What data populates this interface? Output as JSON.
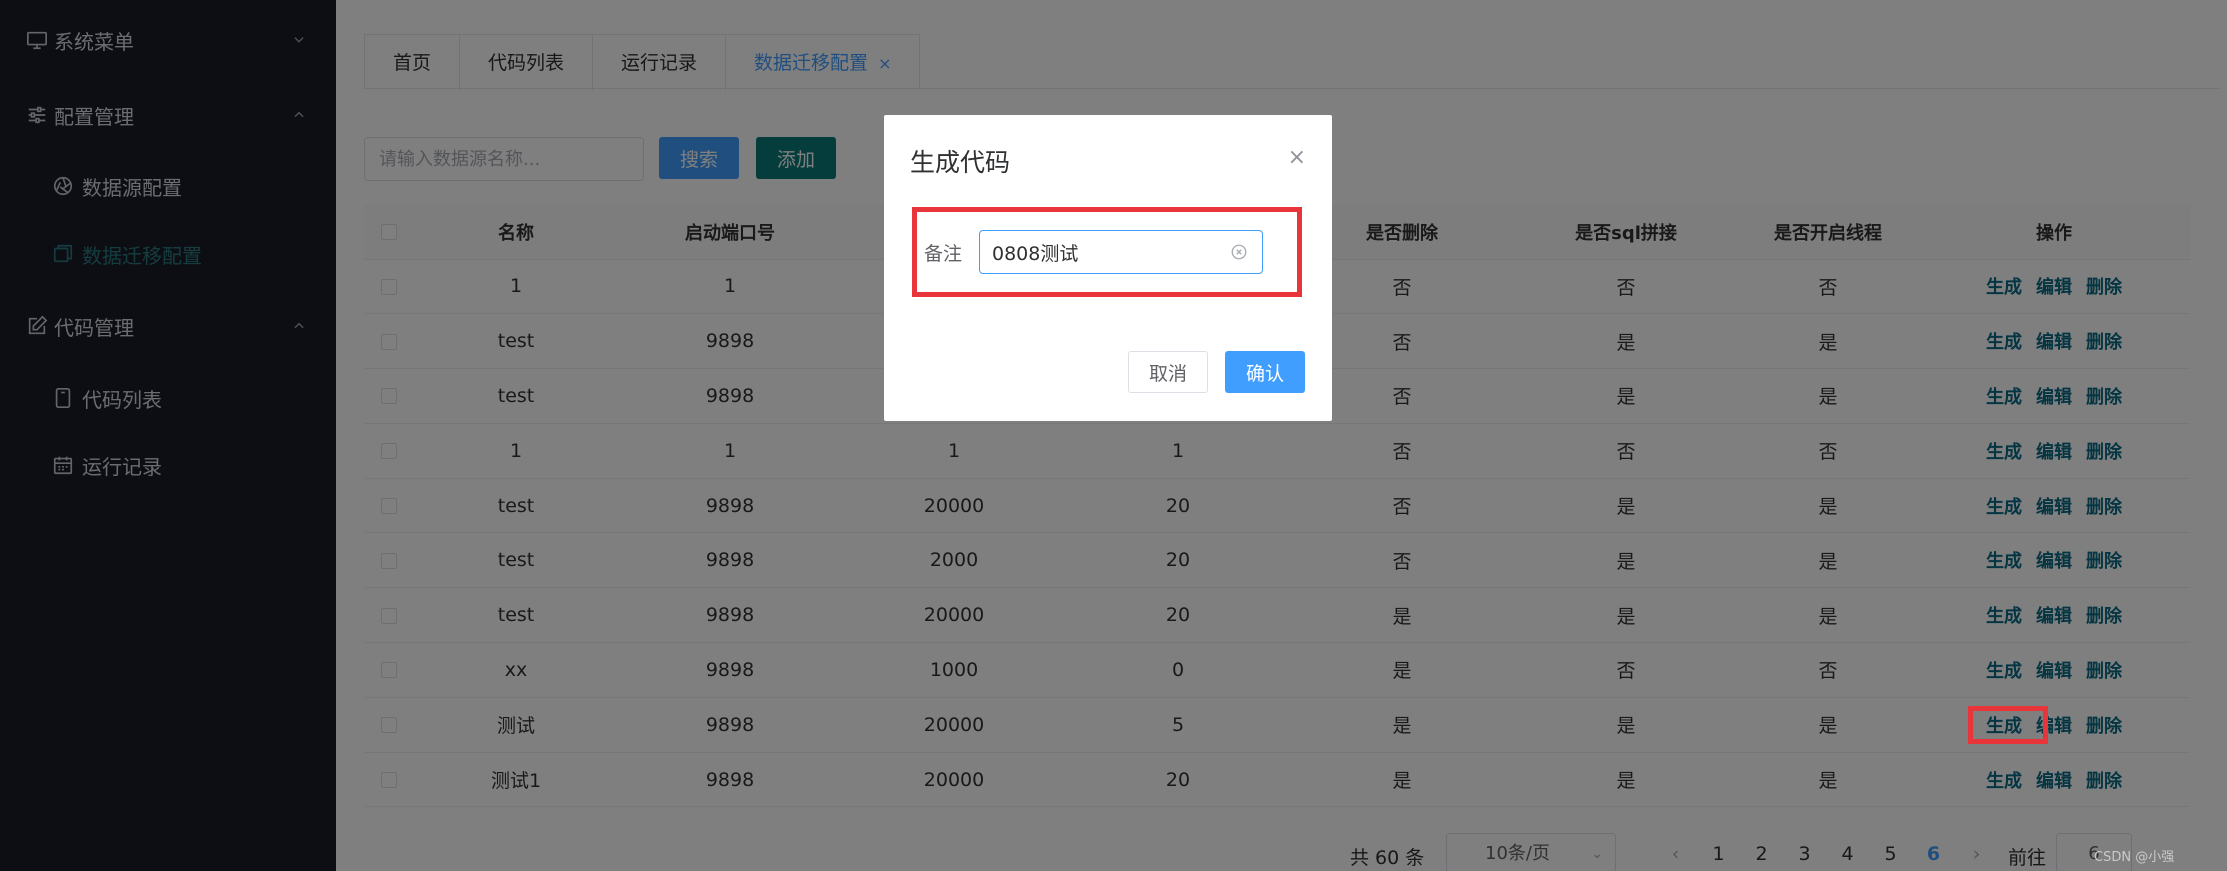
{
  "sidebar": {
    "menus": [
      {
        "label": "系统菜单",
        "expanded": false
      },
      {
        "label": "配置管理",
        "expanded": true,
        "children": [
          {
            "label": "数据源配置",
            "active": false
          },
          {
            "label": "数据迁移配置",
            "active": true
          }
        ]
      },
      {
        "label": "代码管理",
        "expanded": true,
        "children": [
          {
            "label": "代码列表",
            "active": false
          },
          {
            "label": "运行记录",
            "active": false
          }
        ]
      }
    ]
  },
  "tabs": [
    {
      "label": "首页",
      "active": false
    },
    {
      "label": "代码列表",
      "active": false
    },
    {
      "label": "运行记录",
      "active": false
    },
    {
      "label": "数据迁移配置",
      "active": true,
      "close": "×"
    }
  ],
  "toolbar": {
    "search_placeholder": "请输入数据源名称...",
    "search_label": "搜索",
    "add_label": "添加"
  },
  "table": {
    "columns": [
      "名称",
      "启动端口号",
      "",
      "",
      "是否删除",
      "是否sql拼接",
      "是否开启线程",
      "操作"
    ],
    "actions": [
      "生成",
      "编辑",
      "删除"
    ],
    "rows": [
      [
        "1",
        "1",
        "",
        "",
        "否",
        "否",
        "否"
      ],
      [
        "test",
        "9898",
        "",
        "",
        "否",
        "是",
        "是"
      ],
      [
        "test",
        "9898",
        "",
        "",
        "否",
        "是",
        "是"
      ],
      [
        "1",
        "1",
        "1",
        "1",
        "否",
        "否",
        "否"
      ],
      [
        "test",
        "9898",
        "20000",
        "20",
        "否",
        "是",
        "是"
      ],
      [
        "test",
        "9898",
        "2000",
        "20",
        "否",
        "是",
        "是"
      ],
      [
        "test",
        "9898",
        "20000",
        "20",
        "是",
        "是",
        "是"
      ],
      [
        "xx",
        "9898",
        "1000",
        "0",
        "是",
        "否",
        "否"
      ],
      [
        "测试",
        "9898",
        "20000",
        "5",
        "是",
        "是",
        "是"
      ],
      [
        "测试1",
        "9898",
        "20000",
        "20",
        "是",
        "是",
        "是"
      ]
    ]
  },
  "pagination": {
    "total": "共 60 条",
    "page_size": "10条/页",
    "prev": "‹",
    "pages": [
      "1",
      "2",
      "3",
      "4",
      "5",
      "6"
    ],
    "current": "6",
    "next": "›",
    "goto_label": "前往",
    "goto_value": "6"
  },
  "dialog": {
    "title": "生成代码",
    "close": "×",
    "field_label": "备注",
    "field_value": "0808测试",
    "cancel_label": "取消",
    "confirm_label": "确认"
  },
  "watermark": "CSDN @小强",
  "colors": {
    "sidebar_bg": "#1b1d29",
    "primary": "#409eff",
    "teal": "#0b7a78",
    "highlight": "#e8353a"
  }
}
